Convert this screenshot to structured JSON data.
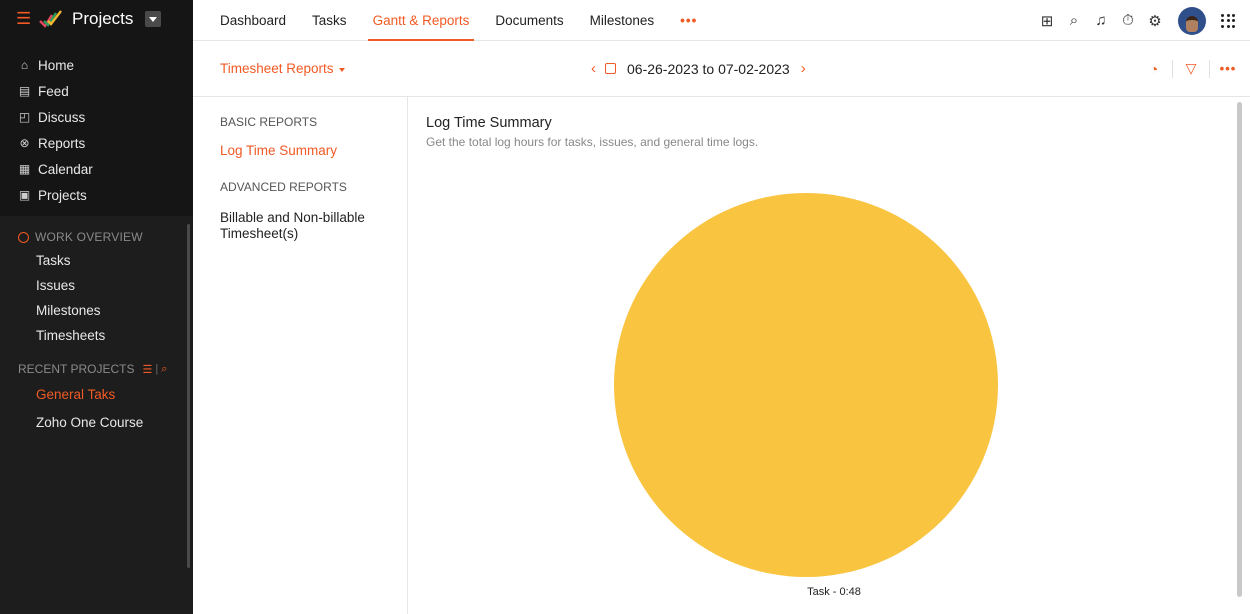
{
  "sidebar": {
    "brand": "Projects",
    "links": [
      {
        "label": "Home",
        "icon": "home-icon",
        "glyph": "⌂"
      },
      {
        "label": "Feed",
        "icon": "feed-icon",
        "glyph": "▤"
      },
      {
        "label": "Discuss",
        "icon": "discuss-icon",
        "glyph": "◰"
      },
      {
        "label": "Reports",
        "icon": "reports-icon",
        "glyph": "⊗"
      },
      {
        "label": "Calendar",
        "icon": "calendar-icon",
        "glyph": "▦"
      },
      {
        "label": "Projects",
        "icon": "projects-icon",
        "glyph": "▣"
      }
    ],
    "work_overview": {
      "title": "WORK OVERVIEW",
      "items": [
        "Tasks",
        "Issues",
        "Milestones",
        "Timesheets"
      ]
    },
    "recent_projects": {
      "title": "RECENT PROJECTS",
      "items": [
        "General Taks",
        "Zoho One Course"
      ],
      "active_index": 0
    }
  },
  "topnav": {
    "tabs": [
      "Dashboard",
      "Tasks",
      "Gantt & Reports",
      "Documents",
      "Milestones"
    ],
    "active_tab": "Gantt & Reports",
    "more": "•••"
  },
  "subbar": {
    "report_selector": "Timesheet Reports",
    "date_range": "06-26-2023 to 07-02-2023"
  },
  "report_nav": {
    "basic_heading": "BASIC REPORTS",
    "basic_items": [
      "Log Time Summary"
    ],
    "advanced_heading": "ADVANCED REPORTS",
    "advanced_items": [
      "Billable and Non-billable Timesheet(s)"
    ]
  },
  "panel": {
    "title": "Log Time Summary",
    "description": "Get the total log hours for tasks, issues, and general time logs."
  },
  "colors": {
    "accent": "#f15a24",
    "pie_task": "#f9c440"
  },
  "chart_data": {
    "type": "pie",
    "slices": [
      {
        "label": "Task - 0:48",
        "value": 48,
        "color": "#f9c440"
      }
    ]
  }
}
